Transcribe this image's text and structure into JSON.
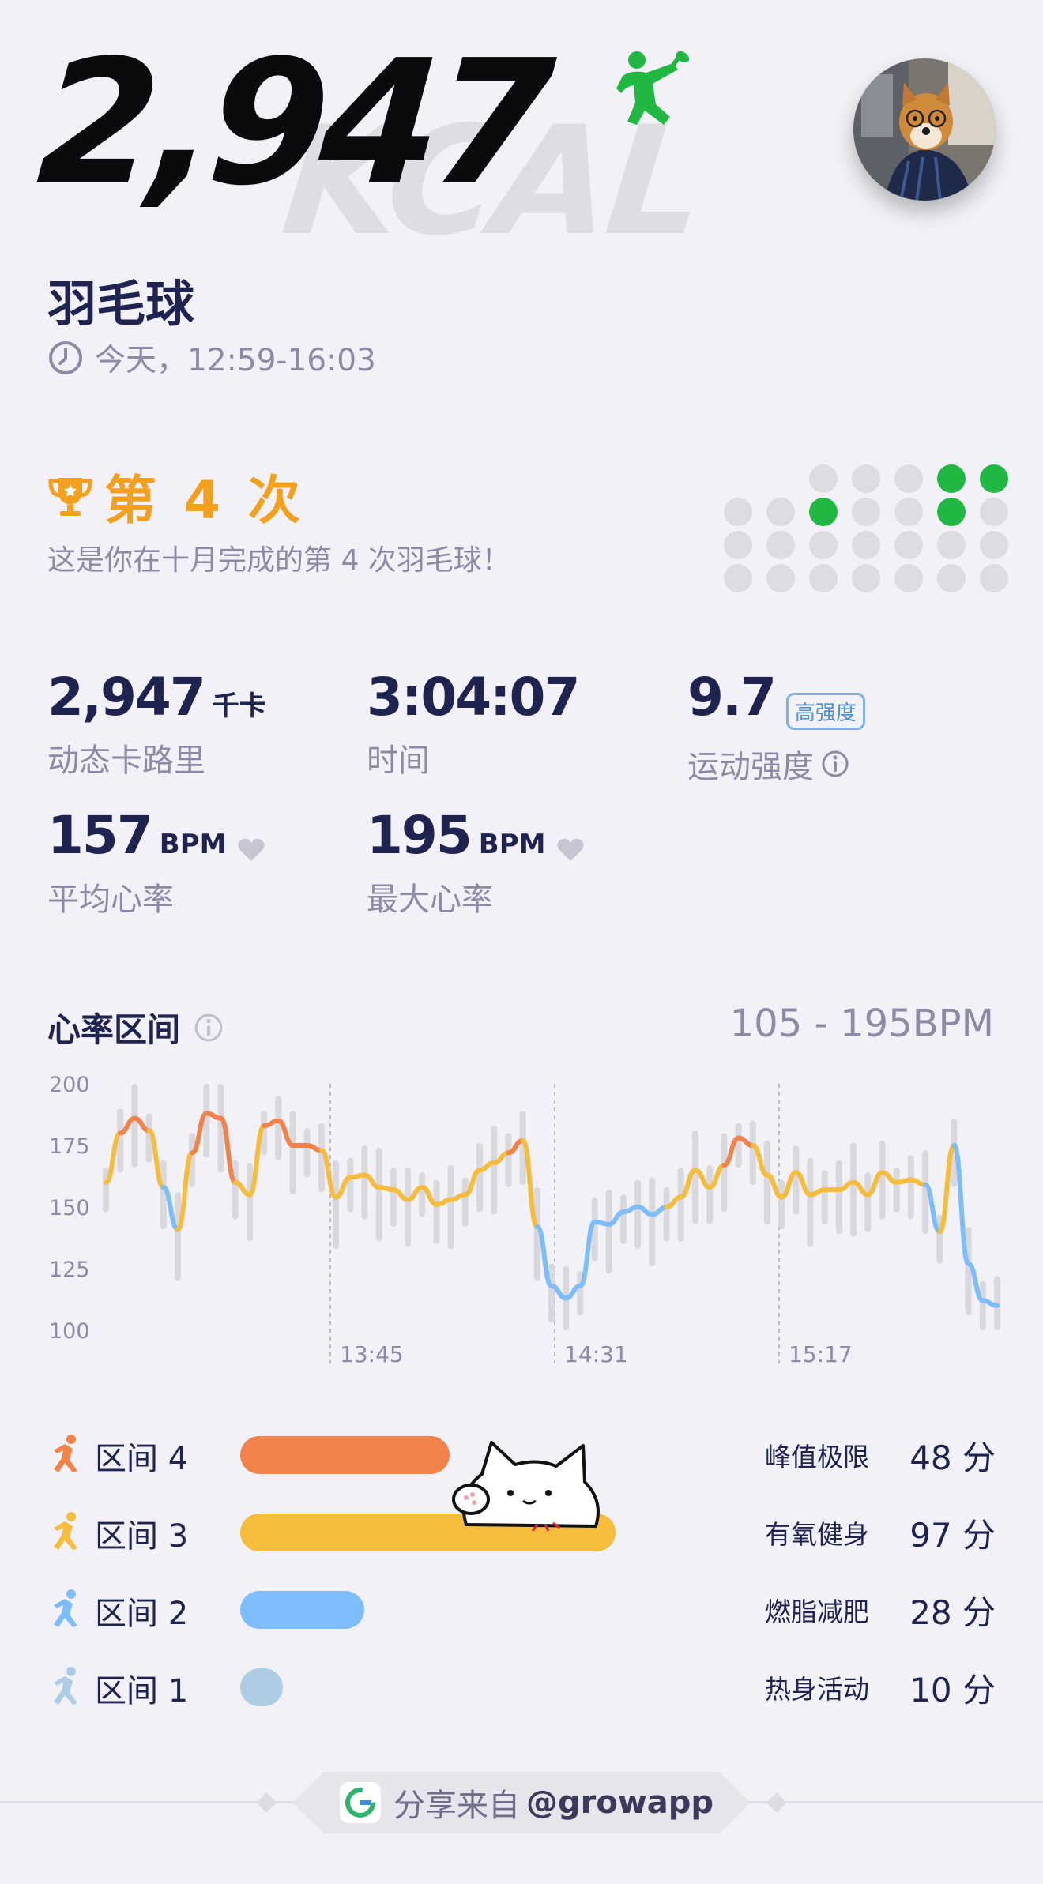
{
  "hero": {
    "calories": "2,947",
    "kcal_word": "KCAL",
    "sport_icon": "badminton-player-icon",
    "avatar_icon": "avatar-photo",
    "sport": "羽毛球",
    "time_text": "今天，12:59-16:03"
  },
  "achievement": {
    "title": "第 4 次",
    "subtitle": "这是你在十月完成的第 4 次羽毛球！",
    "highlight_color": "#20b843"
  },
  "stats": {
    "calories": {
      "value": "2,947",
      "unit": "千卡",
      "label": "动态卡路里"
    },
    "duration": {
      "value": "3:04:07",
      "label": "时间"
    },
    "intensity": {
      "value": "9.7",
      "badge": "高强度",
      "label": "运动强度"
    },
    "avg_hr": {
      "value": "157",
      "unit": "BPM",
      "label": "平均心率"
    },
    "max_hr": {
      "value": "195",
      "unit": "BPM",
      "label": "最大心率"
    }
  },
  "heart_rate": {
    "title": "心率区间",
    "range": "105 - 195BPM"
  },
  "chart_data": {
    "type": "line",
    "y_ticks": [
      "200",
      "175",
      "150",
      "125",
      "100"
    ],
    "ylim": [
      100,
      200
    ],
    "x_ticks": [
      "13:45",
      "14:31",
      "15:17"
    ],
    "series": [
      {
        "values": [
          160,
          180,
          186,
          181,
          158,
          141,
          172,
          188,
          186,
          160,
          155,
          183,
          185,
          175,
          175,
          173,
          154,
          162,
          163,
          158,
          157,
          153,
          158,
          151,
          153,
          155,
          165,
          168,
          172,
          177,
          142,
          118,
          113,
          118,
          144,
          143,
          148,
          150,
          147,
          150,
          154,
          165,
          158,
          167,
          178,
          175,
          163,
          154,
          164,
          155,
          157,
          157,
          160,
          155,
          164,
          160,
          161,
          159,
          140,
          175,
          127,
          112,
          110
        ]
      }
    ],
    "zone_colors": {
      "zone4": "#f0824a",
      "zone3": "#f6bc3c",
      "zone2": "#7dbdfb",
      "zone1": "#aecde4"
    }
  },
  "zones": [
    {
      "name": "区间 4",
      "desc": "峰值极限",
      "minutes": "48 分",
      "fraction": 0.49,
      "color": "#f0824a",
      "icon": "running-icon"
    },
    {
      "name": "区间 3",
      "desc": "有氧健身",
      "minutes": "97 分",
      "fraction": 1.0,
      "color": "#f6bc3c",
      "icon": "jogging-icon"
    },
    {
      "name": "区间 2",
      "desc": "燃脂减肥",
      "minutes": "28 分",
      "fraction": 0.29,
      "color": "#7dbdfb",
      "icon": "walking-icon"
    },
    {
      "name": "区间 1",
      "desc": "热身活动",
      "minutes": "10 分",
      "fraction": 0.1,
      "color": "#aecde4",
      "icon": "stretching-icon"
    }
  ],
  "footer": {
    "prefix": "分享来自",
    "handle": "@growapp",
    "logo_icon": "grow-app-logo"
  }
}
